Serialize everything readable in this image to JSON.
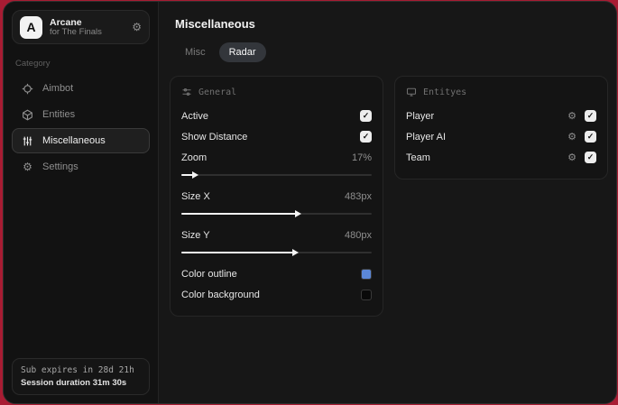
{
  "sidebar": {
    "brand": {
      "initial": "A",
      "title": "Arcane",
      "subtitle": "for The Finals"
    },
    "category_label": "Category",
    "items": [
      {
        "label": "Aimbot",
        "icon": "crosshair-icon",
        "active": false
      },
      {
        "label": "Entities",
        "icon": "cube-icon",
        "active": false
      },
      {
        "label": "Miscellaneous",
        "icon": "sliders-icon",
        "active": true
      },
      {
        "label": "Settings",
        "icon": "gear-icon",
        "active": false
      }
    ],
    "footer": {
      "line1": "Sub expires in 28d 21h",
      "line2": "Session duration 31m 30s"
    }
  },
  "main": {
    "title": "Miscellaneous",
    "tabs": [
      {
        "label": "Misc",
        "active": false
      },
      {
        "label": "Radar",
        "active": true
      }
    ],
    "panels": {
      "general": {
        "header": "General",
        "toggles": [
          {
            "label": "Active",
            "checked": true
          },
          {
            "label": "Show Distance",
            "checked": true
          }
        ],
        "sliders": [
          {
            "label": "Zoom",
            "value": "17%",
            "percent": 6
          },
          {
            "label": "Size X",
            "value": "483px",
            "percent": 60
          },
          {
            "label": "Size Y",
            "value": "480px",
            "percent": 59
          }
        ],
        "colors": [
          {
            "label": "Color outline",
            "swatch": "#5b87d7"
          },
          {
            "label": "Color background",
            "swatch": "#0a0a0a"
          }
        ]
      },
      "entities": {
        "header": "Entityes",
        "rows": [
          {
            "label": "Player",
            "checked": true
          },
          {
            "label": "Player AI",
            "checked": true
          },
          {
            "label": "Team",
            "checked": true
          }
        ]
      }
    }
  },
  "icons": {
    "gear_glyph": "⚙"
  },
  "colors": {
    "backdrop_red": "#a81c33",
    "swatch_blue": "#5b87d7",
    "swatch_black": "#0a0a0a"
  }
}
